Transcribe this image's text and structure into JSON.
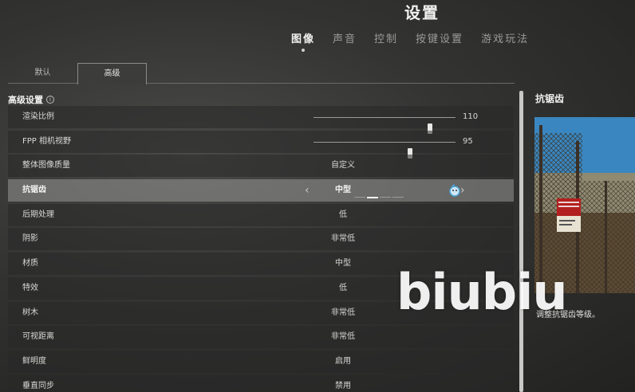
{
  "header": {
    "title": "设置",
    "tabs": [
      {
        "label": "图像",
        "active": true
      },
      {
        "label": "声音",
        "active": false
      },
      {
        "label": "控制",
        "active": false
      },
      {
        "label": "按键设置",
        "active": false
      },
      {
        "label": "游戏玩法",
        "active": false
      }
    ]
  },
  "sub_tabs": {
    "default_label": "默认",
    "advanced_label": "高级",
    "active": "高级"
  },
  "section": {
    "title": "高级设置",
    "info_icon": "info-circle-icon"
  },
  "settings": {
    "render_scale": {
      "label": "渲染比例",
      "value": "110",
      "fraction": 0.82
    },
    "fpp_fov": {
      "label": "FPP 相机视野",
      "value": "95",
      "fraction": 0.68
    },
    "overall_quality": {
      "label": "整体图像质量",
      "value": "自定义"
    },
    "anti_aliasing": {
      "label": "抗锯齿",
      "value": "中型",
      "level": 2,
      "levels": 4
    },
    "post_processing": {
      "label": "后期处理",
      "value": "低"
    },
    "shadows": {
      "label": "阴影",
      "value": "非常低"
    },
    "textures": {
      "label": "材质",
      "value": "中型"
    },
    "effects": {
      "label": "特效",
      "value": "低"
    },
    "foliage": {
      "label": "树木",
      "value": "非常低"
    },
    "view_distance": {
      "label": "可视距离",
      "value": "非常低"
    },
    "sharpen": {
      "label": "鲜明度",
      "value": "启用"
    },
    "vsync": {
      "label": "垂直同步",
      "value": "禁用"
    }
  },
  "side_panel": {
    "title": "抗锯齿",
    "description": "调整抗锯齿等级。"
  },
  "watermark": "biubiu",
  "colors": {
    "selected_row": "#969694",
    "row_bg": "#2a2a2a",
    "preview_sky": "#2f7fb8"
  }
}
